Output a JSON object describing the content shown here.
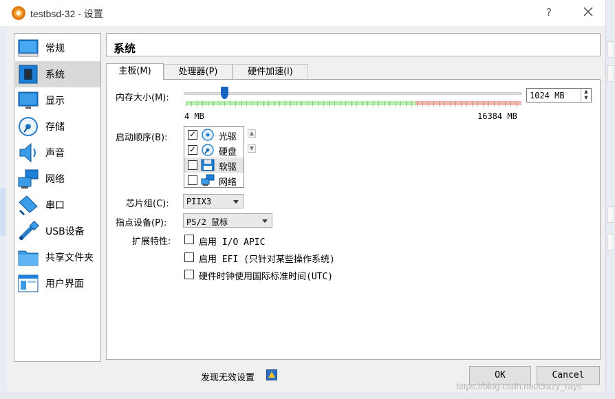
{
  "window": {
    "title": "testbsd-32 - 设置",
    "help": "?"
  },
  "sidebar": {
    "items": [
      {
        "label": "常规",
        "icon": "general-icon"
      },
      {
        "label": "系统",
        "icon": "system-icon",
        "selected": true
      },
      {
        "label": "显示",
        "icon": "display-icon"
      },
      {
        "label": "存储",
        "icon": "storage-icon"
      },
      {
        "label": "声音",
        "icon": "audio-icon"
      },
      {
        "label": "网络",
        "icon": "network-icon"
      },
      {
        "label": "串口",
        "icon": "serial-port-icon"
      },
      {
        "label": "USB设备",
        "icon": "usb-icon"
      },
      {
        "label": "共享文件夹",
        "icon": "shared-folder-icon"
      },
      {
        "label": "用户界面",
        "icon": "user-interface-icon"
      }
    ]
  },
  "section": {
    "title": "系统"
  },
  "tabs": [
    {
      "label": "主板(M)",
      "active": true
    },
    {
      "label": "处理器(P)"
    },
    {
      "label": "硬件加速(l)"
    }
  ],
  "motherboard": {
    "memory": {
      "label": "内存大小(M):",
      "value": "1024 MB",
      "min_label": "4 MB",
      "max_label": "16384 MB",
      "value_mb": 1024,
      "min_mb": 4,
      "max_mb": 16384
    },
    "boot_order": {
      "label": "启动顺序(B):",
      "items": [
        {
          "label": "光驱",
          "checked": true,
          "icon": "optical-drive-icon"
        },
        {
          "label": "硬盘",
          "checked": true,
          "icon": "hard-disk-icon"
        },
        {
          "label": "软驱",
          "checked": false,
          "icon": "floppy-icon",
          "selected": true
        },
        {
          "label": "网络",
          "checked": false,
          "icon": "network-boot-icon"
        }
      ]
    },
    "chipset": {
      "label": "芯片组(C):",
      "value": "PIIX3"
    },
    "pointing_device": {
      "label": "指点设备(P):",
      "value": "PS/2 鼠标"
    },
    "extended": {
      "label": "扩展特性:",
      "options": [
        {
          "label": "启用 I/O APIC",
          "checked": false
        },
        {
          "label": "启用 EFI (只针对某些操作系统)",
          "checked": false
        },
        {
          "label": "硬件时钟使用国际标准时间(UTC)",
          "checked": false
        }
      ]
    }
  },
  "footer": {
    "warning": "发现无效设置",
    "ok": "OK",
    "cancel": "Cancel"
  },
  "watermark": "https://blog.csdn.net/crazy_rays",
  "colors": {
    "accent": "#1565c0",
    "selected_nav": "#d9d9d9",
    "ok_range": "#b6f0b0",
    "bad_range": "#f6b4ac"
  }
}
